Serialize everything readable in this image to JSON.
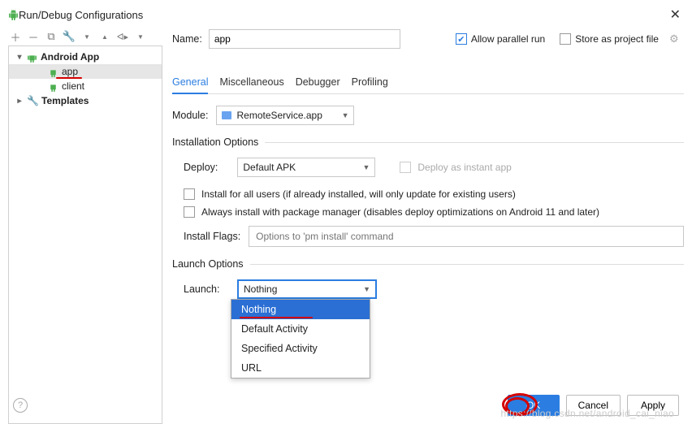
{
  "window": {
    "title": "Run/Debug Configurations"
  },
  "toolbar_icons": [
    "+",
    "−",
    "⧉",
    "🔧",
    "▾",
    "▸",
    "⇅",
    "▾"
  ],
  "tree": {
    "root": "Android App",
    "items": [
      {
        "label": "app"
      },
      {
        "label": "client"
      }
    ],
    "templates": "Templates"
  },
  "name": {
    "label": "Name:",
    "value": "app"
  },
  "allow_parallel": {
    "label": "Allow parallel run"
  },
  "store_project": {
    "label": "Store as project file"
  },
  "tabs": [
    "General",
    "Miscellaneous",
    "Debugger",
    "Profiling"
  ],
  "module": {
    "label": "Module:",
    "value": "RemoteService.app"
  },
  "install": {
    "section": "Installation Options",
    "deploy_label": "Deploy:",
    "deploy_value": "Default APK",
    "instant": "Deploy as instant app",
    "all_users": "Install for all users (if already installed, will only update for existing users)",
    "pkg_mgr": "Always install with package manager (disables deploy optimizations on Android 11 and later)",
    "flags_label": "Install Flags:",
    "flags_placeholder": "Options to 'pm install' command"
  },
  "launch": {
    "section": "Launch Options",
    "label": "Launch:",
    "value": "Nothing",
    "options": [
      "Nothing",
      "Default Activity",
      "Specified Activity",
      "URL"
    ]
  },
  "buttons": {
    "ok": "OK",
    "cancel": "Cancel",
    "apply": "Apply"
  },
  "watermark": "https://blog.csdn.net/android_cai_niao"
}
